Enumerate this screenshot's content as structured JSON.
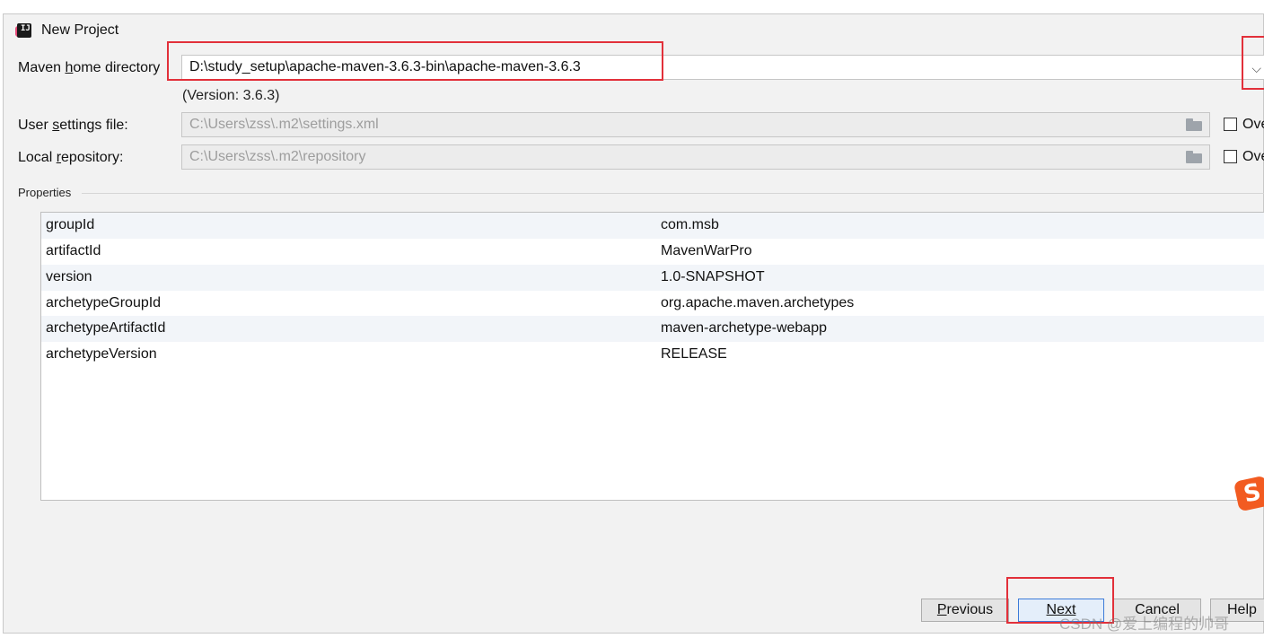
{
  "window": {
    "title": "New Project",
    "app_icon_text": "IJ"
  },
  "maven": {
    "home_label_pre": "Maven ",
    "home_label_mn": "h",
    "home_label_post": "ome directory",
    "home_value": "D:\\study_setup\\apache-maven-3.6.3-bin\\apache-maven-3.6.3",
    "version_text": "(Version: 3.6.3)",
    "settings_label_pre": "User ",
    "settings_label_mn": "s",
    "settings_label_post": "ettings file:",
    "settings_value": "C:\\Users\\zss\\.m2\\settings.xml",
    "repo_label_pre": "Local ",
    "repo_label_mn": "r",
    "repo_label_post": "epository:",
    "repo_value": "C:\\Users\\zss\\.m2\\repository",
    "override_label": "Ove"
  },
  "properties": {
    "title": "Properties",
    "rows": [
      {
        "key": "groupId",
        "value": "com.msb"
      },
      {
        "key": "artifactId",
        "value": "MavenWarPro"
      },
      {
        "key": "version",
        "value": "1.0-SNAPSHOT"
      },
      {
        "key": "archetypeGroupId",
        "value": "org.apache.maven.archetypes"
      },
      {
        "key": "archetypeArtifactId",
        "value": "maven-archetype-webapp"
      },
      {
        "key": "archetypeVersion",
        "value": "RELEASE"
      }
    ]
  },
  "buttons": {
    "previous_mn": "P",
    "previous_rest": "revious",
    "next_mn": "N",
    "next_rest": "ext",
    "cancel": "Cancel",
    "help": "Help"
  },
  "overlay": {
    "watermark": "CSDN @爱上编程的帅哥",
    "ime_logo": "S",
    "highlight_color": "#e2303a"
  }
}
